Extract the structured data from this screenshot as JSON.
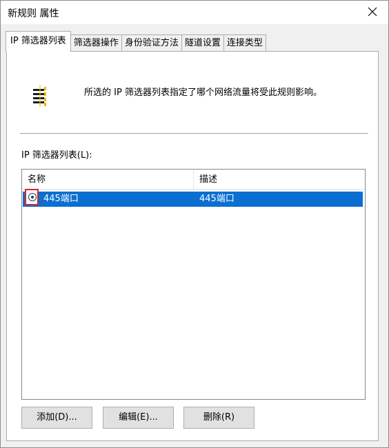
{
  "window": {
    "title": "新规则 属性"
  },
  "tabs": [
    {
      "label": "IP 筛选器列表"
    },
    {
      "label": "筛选器操作"
    },
    {
      "label": "身份验证方法"
    },
    {
      "label": "隧道设置"
    },
    {
      "label": "连接类型"
    }
  ],
  "info": {
    "icon": "filter-list-icon",
    "text": "所选的 IP 筛选器列表指定了哪个网络流量将受此规则影响。"
  },
  "list": {
    "label": "IP 筛选器列表(L):",
    "columns": [
      "名称",
      "描述"
    ],
    "rows": [
      {
        "name": "445端口",
        "description": "445端口",
        "selected": true
      }
    ]
  },
  "buttons": {
    "add": "添加(D)...",
    "edit": "编辑(E)...",
    "delete": "删除(R)"
  },
  "colors": {
    "selection": "#0a6fd1",
    "highlight_box": "#e0201f"
  }
}
